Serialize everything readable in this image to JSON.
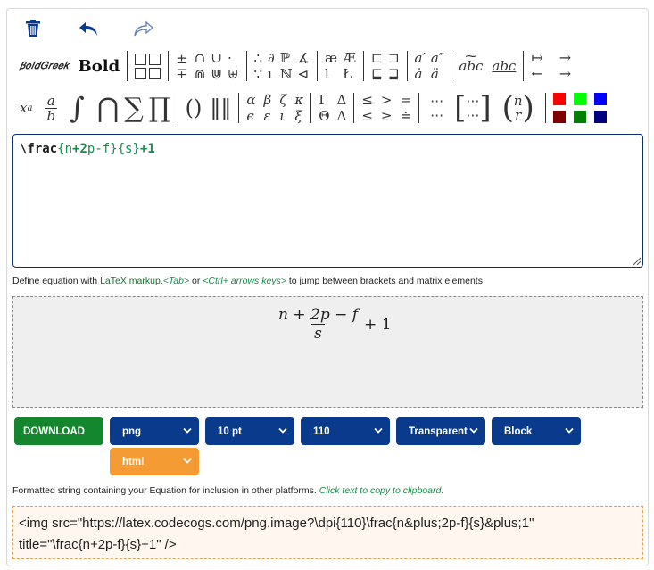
{
  "colors": {
    "accent_blue": "#0a3a8c",
    "download_green": "#13862e",
    "orange": "#f59b33",
    "code_green": "#1b8a4b",
    "swatches": [
      "#ff0000",
      "#00ff00",
      "#0000ff",
      "#800000",
      "#008000",
      "#000080"
    ]
  },
  "toolbar": {
    "top_actions": [
      {
        "name": "trash-icon"
      },
      {
        "name": "undo-icon"
      },
      {
        "name": "redo-icon"
      }
    ],
    "row1": {
      "bold_greek": "𝛽𝑜𝑙𝑑𝐺𝑟𝑒𝑒𝑘",
      "bold": "Bold",
      "pm": {
        "top": "±",
        "bottom": "∓"
      },
      "cap_cup": [
        "∩",
        "∪",
        "⋅",
        "⋒",
        "⋓",
        "⊎"
      ],
      "logic": [
        "∴",
        "∂",
        "ℙ",
        "∡",
        "∵",
        "ı",
        "ℕ",
        "⊲"
      ],
      "ligatures": [
        "æ",
        "Æ",
        "l",
        "Ł"
      ],
      "subsets": [
        "⊏",
        "⊐",
        "⊑",
        "⊒"
      ],
      "accents": [
        "a′",
        "a″",
        "ȧ",
        "ä"
      ],
      "wide": [
        "abc",
        "abc"
      ],
      "arrows": [
        "↦",
        "→",
        "←",
        "→"
      ]
    },
    "row2": {
      "power": {
        "base": "x",
        "exp": "a"
      },
      "frac": {
        "num": "a",
        "den": "b"
      },
      "bigops": [
        "∫",
        "⋂",
        "∑",
        "∏"
      ],
      "delims": [
        "(",
        ")",
        "‖",
        "‖"
      ],
      "greek": [
        "α",
        "β",
        "ζ",
        "κ",
        "ϵ",
        "ε",
        "ι",
        "ξ"
      ],
      "upper_greek": [
        "Γ",
        "Δ",
        "Θ",
        "Λ"
      ],
      "relations": [
        "≤",
        ">",
        "=",
        "≤",
        "≥",
        "≐"
      ],
      "dots": [
        "⋯",
        "⋯"
      ],
      "matrix": [
        "⋯",
        "⋯"
      ],
      "binom": {
        "top": "n",
        "bottom": "r"
      }
    }
  },
  "editor": {
    "cmd": "\\frac",
    "arg1_open": "{",
    "arg1_a": "n",
    "arg1_b": "+2",
    "arg1_c": "p-f}",
    "arg2": "{s}",
    "tail": "+1"
  },
  "hint": {
    "pre": "Define equation with ",
    "link": "LaTeX markup",
    "dot": ".",
    "tab": "<Tab>",
    "or": " or ",
    "ctrl": "<Ctrl+ arrows keys>",
    "post": " to jump between brackets and matrix elements."
  },
  "preview": {
    "numerator": "n + 2p − f",
    "denominator": "s",
    "tail": "+ 1"
  },
  "controls": {
    "download": "DOWNLOAD",
    "format": "png",
    "size": "10 pt",
    "dpi": "110",
    "background": "Transparent",
    "display": "Block",
    "output_type": "html"
  },
  "format_text": {
    "pre": "Formatted string containing your Equation for inclusion in other platforms. ",
    "click": "Click text to copy to clipboard."
  },
  "output": {
    "line1": "<img src=\"https://latex.codecogs.com/png.image?\\dpi{110}\\frac{n&plus;2p-f}{s}&plus;1\"",
    "line2": "title=\"\\frac{n+2p-f}{s}+1\" />"
  }
}
